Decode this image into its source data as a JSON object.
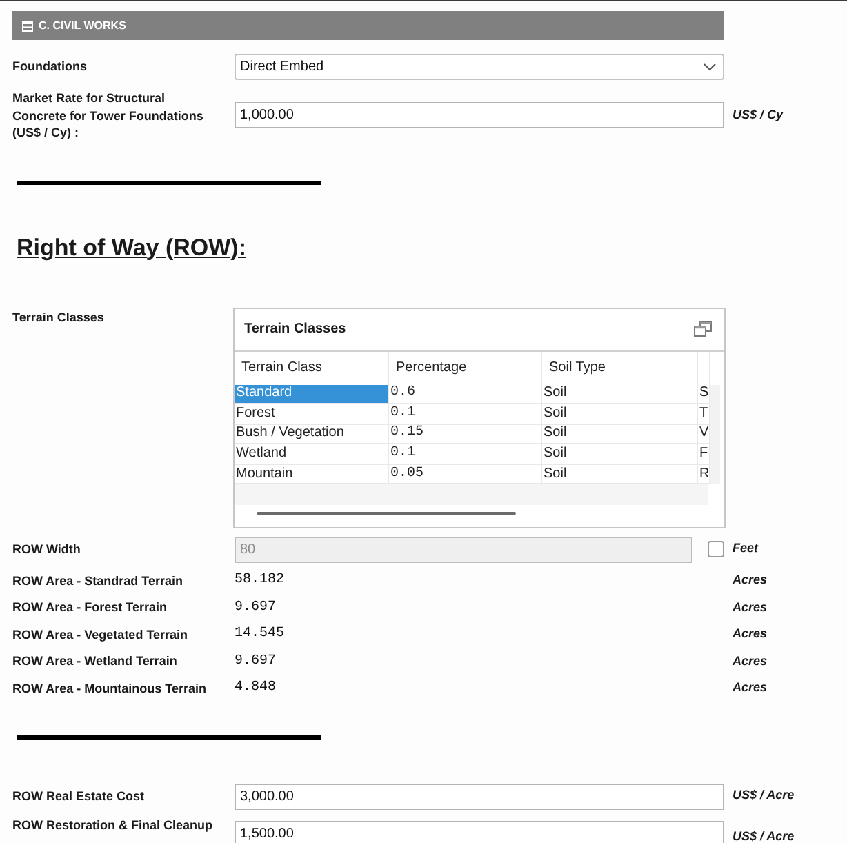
{
  "section": {
    "title": "C. CIVIL WORKS"
  },
  "structural_fields": [
    {
      "kind": "select",
      "label": "Foundations",
      "value": "Direct Embed"
    },
    {
      "kind": "input",
      "label": "Market Rate for Structural Concrete for Tower Foundations (US$ / Cy) :",
      "value": "1,000.00",
      "unit": "US$ / Cy",
      "disabled": false
    }
  ],
  "right_of_way": {
    "heading": "Right of Way (ROW):",
    "terrain_classes": {
      "label": "Terrain Classes",
      "panel_title": "Terrain Classes",
      "columns": [
        "Terrain Class",
        "Percentage",
        "Soil Type"
      ],
      "rows": [
        {
          "selected": true,
          "cells": [
            "Standard",
            "0.6",
            "Soil",
            "S"
          ]
        },
        {
          "selected": false,
          "cells": [
            "Forest",
            "0.1",
            "Soil",
            "T"
          ]
        },
        {
          "selected": false,
          "cells": [
            "Bush / Vegetation",
            "0.15",
            "Soil",
            "V"
          ]
        },
        {
          "selected": false,
          "cells": [
            "Wetland",
            "0.1",
            "Soil",
            "F"
          ]
        },
        {
          "selected": false,
          "cells": [
            "Mountain",
            "0.05",
            "Soil",
            "R"
          ]
        }
      ]
    },
    "width_and_area_fields": [
      {
        "kind": "input",
        "label": "ROW Width",
        "value": "80",
        "disabled": true,
        "checkbox": {
          "checked": false
        },
        "unit": "Feet"
      },
      {
        "kind": "readout",
        "label": "ROW Area - Standrad Terrain",
        "value": "58.182",
        "unit": "Acres"
      },
      {
        "kind": "readout",
        "label": "ROW Area - Forest Terrain",
        "value": "9.697",
        "unit": "Acres"
      },
      {
        "kind": "readout",
        "label": "ROW Area - Vegetated Terrain",
        "value": "14.545",
        "unit": "Acres"
      },
      {
        "kind": "readout",
        "label": "ROW Area - Wetland Terrain",
        "value": "9.697",
        "unit": "Acres"
      },
      {
        "kind": "readout",
        "label": "ROW Area - Mountainous Terrain",
        "value": "4.848",
        "unit": "Acres"
      }
    ],
    "cost_fields": [
      {
        "kind": "input",
        "label": "ROW Real Estate Cost",
        "value": "3,000.00",
        "unit": "US$ / Acre",
        "disabled": false
      },
      {
        "kind": "input",
        "label": "ROW Restoration & Final Cleanup",
        "value": "1,500.00",
        "unit": "US$ / Acre",
        "disabled": false
      }
    ]
  }
}
